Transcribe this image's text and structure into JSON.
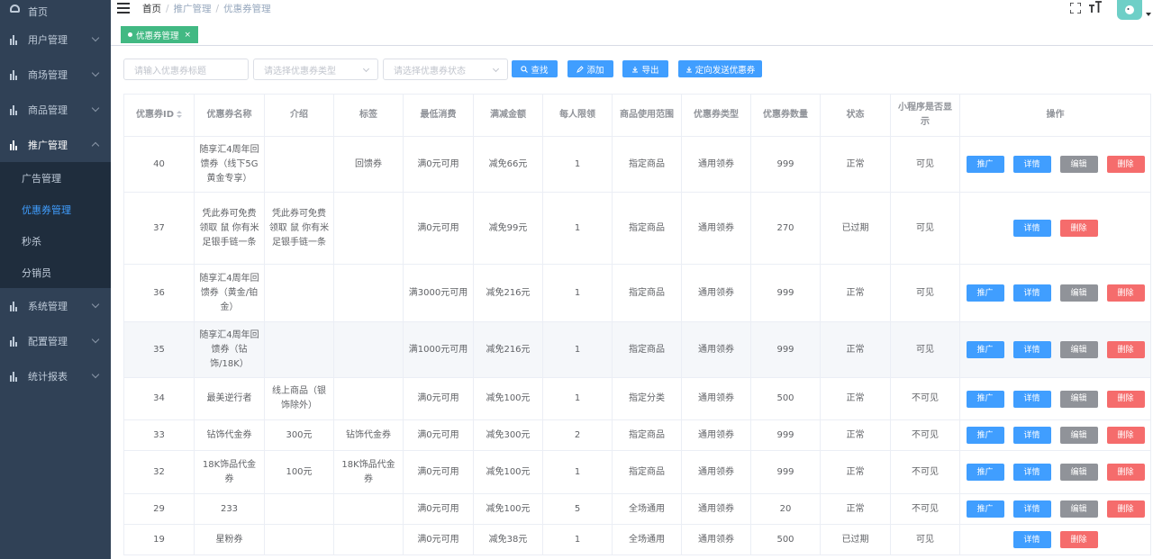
{
  "sidebar": {
    "home": "首页",
    "items": [
      {
        "label": "用户管理"
      },
      {
        "label": "商场管理"
      },
      {
        "label": "商品管理"
      },
      {
        "label": "推广管理"
      },
      {
        "label": "系统管理"
      },
      {
        "label": "配置管理"
      },
      {
        "label": "统计报表"
      }
    ],
    "submenu": [
      {
        "label": "广告管理"
      },
      {
        "label": "优惠券管理"
      },
      {
        "label": "秒杀"
      },
      {
        "label": "分销员"
      }
    ]
  },
  "breadcrumb": [
    "首页",
    "推广管理",
    "优惠券管理"
  ],
  "tag": {
    "label": "优惠券管理",
    "close": "×"
  },
  "filters": {
    "title_placeholder": "请输入优惠券标题",
    "type_placeholder": "请选择优惠券类型",
    "status_placeholder": "请选择优惠券状态",
    "search": "查找",
    "add": "添加",
    "export": "导出",
    "send": "定向发送优惠券"
  },
  "table": {
    "columns": [
      "优惠券ID",
      "优惠券名称",
      "介绍",
      "标签",
      "最低消费",
      "满减金额",
      "每人限领",
      "商品使用范围",
      "优惠券类型",
      "优惠券数量",
      "状态",
      "小程序是否显示",
      "操作"
    ],
    "buttons": {
      "promote": "推广",
      "detail": "详情",
      "edit": "编辑",
      "delete": "删除"
    },
    "rows": [
      {
        "id": "40",
        "name": "随享汇4周年回馈券（线下5G黄金专享）",
        "intro": "",
        "tag": "回馈券",
        "min": "满0元可用",
        "discount": "减免66元",
        "limit": "1",
        "scope": "指定商品",
        "type": "通用领券",
        "qty": "999",
        "status": "正常",
        "show": "可见",
        "full_ops": true
      },
      {
        "id": "37",
        "name": "凭此券可免费领取 鼠 你有米足银手链一条",
        "intro": "凭此券可免费领取 鼠 你有米足银手链一条",
        "tag": "",
        "min": "满0元可用",
        "discount": "减免99元",
        "limit": "1",
        "scope": "指定商品",
        "type": "通用领券",
        "qty": "270",
        "status": "已过期",
        "show": "可见",
        "full_ops": false
      },
      {
        "id": "36",
        "name": "随享汇4周年回馈券（黄金/铂金）",
        "intro": "",
        "tag": "",
        "min": "满3000元可用",
        "discount": "减免216元",
        "limit": "1",
        "scope": "指定商品",
        "type": "通用领券",
        "qty": "999",
        "status": "正常",
        "show": "可见",
        "full_ops": true
      },
      {
        "id": "35",
        "name": "随享汇4周年回馈券（钻饰/18K）",
        "intro": "",
        "tag": "",
        "min": "满1000元可用",
        "discount": "减免216元",
        "limit": "1",
        "scope": "指定商品",
        "type": "通用领券",
        "qty": "999",
        "status": "正常",
        "show": "可见",
        "full_ops": true
      },
      {
        "id": "34",
        "name": "最美逆行者",
        "intro": "线上商品（银饰除外）",
        "tag": "",
        "min": "满0元可用",
        "discount": "减免100元",
        "limit": "1",
        "scope": "指定分类",
        "type": "通用领券",
        "qty": "500",
        "status": "正常",
        "show": "不可见",
        "full_ops": true
      },
      {
        "id": "33",
        "name": "钻饰代金券",
        "intro": "300元",
        "tag": "钻饰代金券",
        "min": "满0元可用",
        "discount": "减免300元",
        "limit": "2",
        "scope": "指定商品",
        "type": "通用领券",
        "qty": "999",
        "status": "正常",
        "show": "不可见",
        "full_ops": true
      },
      {
        "id": "32",
        "name": "18K饰品代金券",
        "intro": "100元",
        "tag": "18K饰品代金券",
        "min": "满0元可用",
        "discount": "减免100元",
        "limit": "1",
        "scope": "指定商品",
        "type": "通用领券",
        "qty": "999",
        "status": "正常",
        "show": "不可见",
        "full_ops": true
      },
      {
        "id": "29",
        "name": "233",
        "intro": "",
        "tag": "",
        "min": "满0元可用",
        "discount": "减免100元",
        "limit": "5",
        "scope": "全场通用",
        "type": "通用领券",
        "qty": "20",
        "status": "正常",
        "show": "不可见",
        "full_ops": true
      },
      {
        "id": "19",
        "name": "星粉券",
        "intro": "",
        "tag": "",
        "min": "满0元可用",
        "discount": "减免38元",
        "limit": "1",
        "scope": "全场通用",
        "type": "通用领券",
        "qty": "500",
        "status": "已过期",
        "show": "可见",
        "full_ops": false
      }
    ]
  }
}
